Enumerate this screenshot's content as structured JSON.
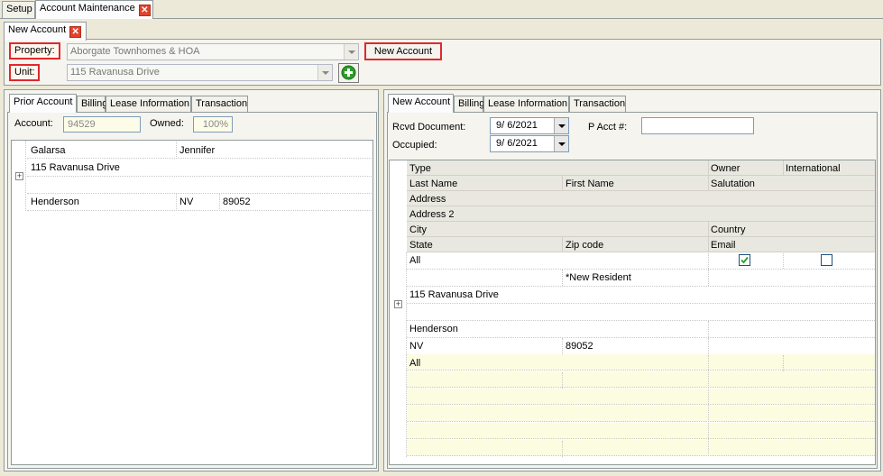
{
  "top_tabs": [
    {
      "label": "Setup"
    },
    {
      "label": "Account Maintenance"
    }
  ],
  "sub_tab": {
    "label": "New Account"
  },
  "property": {
    "label": "Property:",
    "value": "Aborgate Townhomes & HOA"
  },
  "unit": {
    "label": "Unit:",
    "value": "115 Ravanusa Drive"
  },
  "new_account_button": "New Account",
  "left": {
    "tabs": [
      "Prior Account",
      "Billing",
      "Lease Information",
      "Transaction"
    ],
    "account_label": "Account:",
    "account_value": "94529",
    "owned_label": "Owned:",
    "owned_value": "100%",
    "rows": [
      {
        "c1": "Galarsa",
        "c2": "Jennifer",
        "c3": ""
      },
      {
        "c1": "115 Ravanusa Drive",
        "c2": "",
        "c3": ""
      },
      {
        "c1": "",
        "c2": "",
        "c3": ""
      },
      {
        "c1": "Henderson",
        "c2": "NV",
        "c3": "89052"
      }
    ]
  },
  "right": {
    "tabs": [
      "New Account",
      "Billing",
      "Lease Information",
      "Transaction"
    ],
    "rcvd_label": "Rcvd Document:",
    "rcvd_value": "9/  6/2021",
    "pacct_label": "P Acct #:",
    "pacct_value": "",
    "occupied_label": "Occupied:",
    "occupied_value": "9/  6/2021",
    "headers": {
      "type": "Type",
      "owner": "Owner",
      "international": "International",
      "last_name": "Last Name",
      "first_name": "First Name",
      "salutation": "Salutation",
      "address": "Address",
      "address2": "Address 2",
      "city": "City",
      "country": "Country",
      "state": "State",
      "zip": "Zip code",
      "email": "Email"
    },
    "data": {
      "type": "All",
      "owner_checked": true,
      "international_checked": false,
      "first_name": "*New Resident",
      "address": "115 Ravanusa Drive",
      "city": "Henderson",
      "state": "NV",
      "zip": "89052",
      "email": "All"
    }
  },
  "colors": {
    "highlight": "#e0282e",
    "row_yellow": "#fcfce0",
    "header_bg": "#e8e8e0"
  }
}
